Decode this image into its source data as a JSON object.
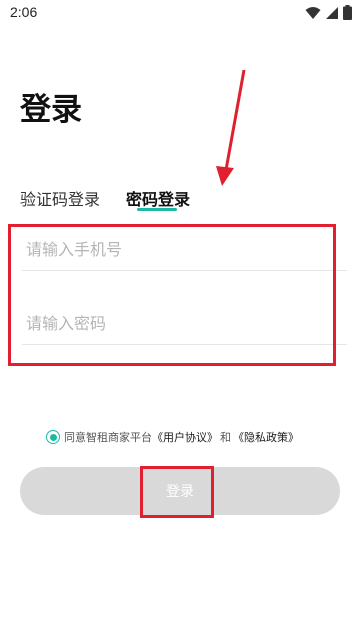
{
  "status_bar": {
    "time": "2:06",
    "icons": [
      "wifi-icon",
      "signal-icon",
      "battery-icon"
    ]
  },
  "page": {
    "title": "登录"
  },
  "tabs": [
    {
      "label": "验证码登录",
      "active": false
    },
    {
      "label": "密码登录",
      "active": true
    }
  ],
  "form": {
    "phone_placeholder": "请输入手机号",
    "phone_value": "",
    "password_placeholder": "请输入密码",
    "password_value": ""
  },
  "agreement": {
    "checked": true,
    "prefix": "同意智租商家平台",
    "user_agreement": "《用户协议》",
    "and": "和",
    "privacy_policy": "《隐私政策》"
  },
  "login_button": {
    "label": "登录"
  },
  "colors": {
    "accent": "#1fb8a5",
    "button_disabled": "#d9d9d9",
    "annotation": "#e0202e"
  }
}
